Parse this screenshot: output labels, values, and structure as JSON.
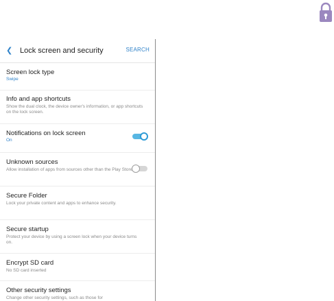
{
  "header": {
    "title": "Lock screen and security",
    "search_label": "SEARCH"
  },
  "settings": [
    {
      "title": "Screen lock type",
      "subtitle": "Swipe"
    },
    {
      "title": "Info and app shortcuts",
      "subtitle": "Show the dual clock, the device owner's information, or app shortcuts on the lock screen."
    },
    {
      "title": "Notifications on lock screen",
      "subtitle": "On",
      "toggle": "on"
    },
    {
      "title": "Unknown sources",
      "subtitle": "Allow installation of apps from sources other than the Play Store.",
      "toggle": "off"
    },
    {
      "title": "Secure Folder",
      "subtitle": "Lock your private content and apps to enhance security."
    },
    {
      "title": "Secure startup",
      "subtitle": "Protect your device by using a screen lock when your device turns on."
    },
    {
      "title": "Encrypt SD card",
      "subtitle": "No SD card inserted"
    },
    {
      "title": "Other security settings",
      "subtitle": "Change other security settings, such as those for"
    }
  ],
  "colors": {
    "accent": "#2f82c9",
    "lock_badge": "#9b88bf",
    "toggle_on": "#58b7e3"
  }
}
